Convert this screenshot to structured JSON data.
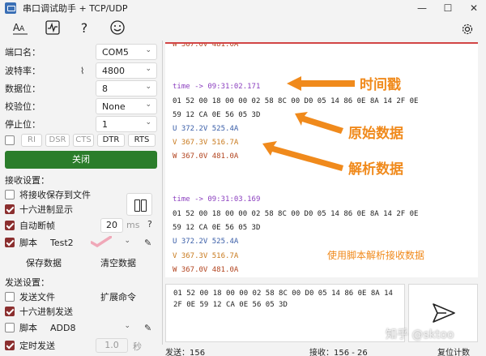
{
  "window": {
    "title": "串口调试助手 + TCP/UDP",
    "controls": [
      "—",
      "☐",
      "✕"
    ]
  },
  "toolbar": {
    "icons": [
      "font-icon",
      "waveform-icon",
      "help-icon",
      "smiley-icon"
    ],
    "help_text": "?"
  },
  "serial": {
    "port_label": "端口名：",
    "port_value": "COM5",
    "baud_label": "波特率：",
    "baud_value": "4800",
    "databits_label": "数据位：",
    "databits_value": "8",
    "parity_label": "校验位：",
    "parity_value": "None",
    "stopbits_label": "停止位：",
    "stopbits_value": "1",
    "signals": [
      "RI",
      "DSR",
      "CTS",
      "DTR",
      "RTS"
    ],
    "close_label": "关闭"
  },
  "receive_settings": {
    "section_label": "接收设置：",
    "save_to_file": "将接收保存到文件",
    "hex_display": "十六进制显示",
    "auto_frame": "自动断帧",
    "frame_ms_value": "20",
    "frame_ms_unit": "ms",
    "frame_help": "?",
    "script_label": "脚本",
    "script_value": "Test2",
    "save_data": "保存数据",
    "clear_data": "清空数据"
  },
  "send_settings": {
    "section_label": "发送设置：",
    "send_file": "发送文件",
    "extend_cmd": "扩展命令",
    "hex_send": "十六进制发送",
    "script_label": "脚本",
    "script_value": "ADD8",
    "timed_send": "定时发送",
    "timed_value": "1.0",
    "timed_unit": "秒"
  },
  "receive": {
    "top_partial": "W  367.0V  481.0A",
    "block1": {
      "time": "time -> 09:31:02.171",
      "hex1": "01 52 00 18 00 00 02 58 8C 00 D0 05 14 86 0E 8A 14 2F 0E",
      "hex2": "59 12 CA 0E 56 05 3D",
      "u": "U   372.2V 525.4A",
      "v": "V   367.3V 516.7A",
      "w": "W   367.0V 481.0A"
    },
    "block2": {
      "time": "time -> 09:31:03.169",
      "hex1": "01 52 00 18 00 00 02 58 8C 00 D0 05 14 86 0E 8A 14 2F 0E",
      "hex2": "59 12 CA 0E 56 05 3D",
      "u": "U   372.2V 525.4A",
      "v": "V   367.3V 516.7A",
      "w": "W   367.0V 481.0A"
    },
    "annotations": {
      "timestamp": "时间戳",
      "raw": "原始数据",
      "parsed": "解析数据",
      "script_note": "使用脚本解析接收数据"
    }
  },
  "send_box": {
    "text": "01 52 00 18 00 00 02 58 8C 00 D0 05 14 86 0E 8A 14 2F 0E 59 12 CA 0E 56 05 3D"
  },
  "status": {
    "sent": "发送：156",
    "received": "接收：156 - 26",
    "reset": "复位计数"
  },
  "watermark": "知乎 @sktoo",
  "colors": {
    "accent_red": "#d24545",
    "close_green": "#2b7d2b",
    "annotation_orange": "#f08a1c",
    "timestamp_purple": "#8b3fbf"
  }
}
